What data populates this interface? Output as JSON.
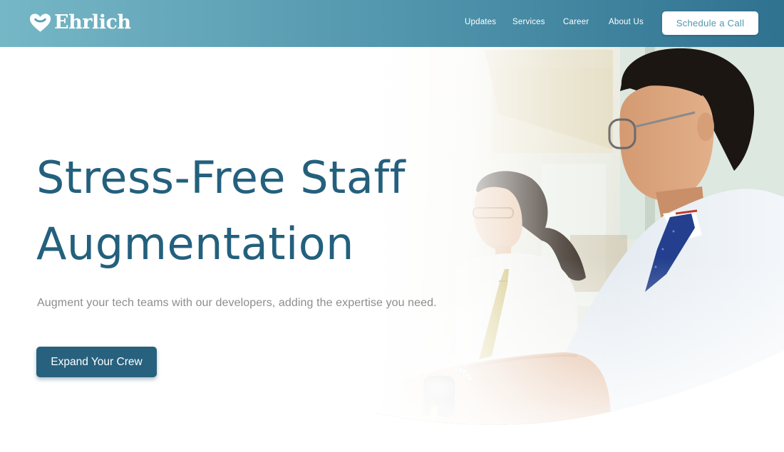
{
  "header": {
    "logo_text": "Ehrlich",
    "nav": [
      {
        "label": "Updates"
      },
      {
        "label": "Services"
      },
      {
        "label": "Career"
      },
      {
        "label": "About Us"
      }
    ],
    "cta_label": "Schedule a Call"
  },
  "hero": {
    "headline_line1": "Stress-Free Staff",
    "headline_line2": "Augmentation",
    "subtitle": "Augment your tech teams with our developers, adding the expertise you need.",
    "button_label": "Expand Your Crew",
    "photo_description": "two-professionals-working-at-laptops"
  },
  "colors": {
    "header_gradient_start": "#76b7c6",
    "header_gradient_end": "#2f7290",
    "headline": "#23607d",
    "subtitle": "#8d8d8d",
    "primary_button": "#27617e",
    "cta_text": "#4f97ae"
  },
  "icons": {
    "logo": "heart-logo-icon"
  }
}
